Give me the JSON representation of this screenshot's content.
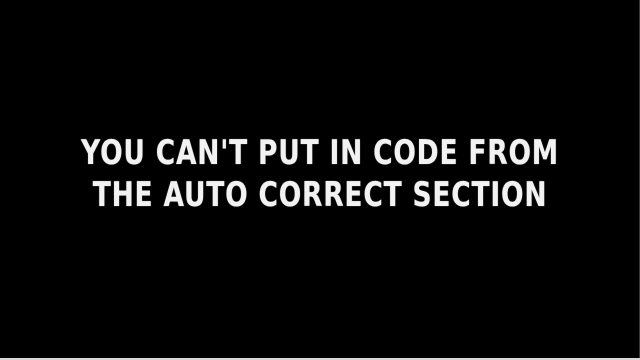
{
  "caption": {
    "line1": "YOU CAN'T PUT IN CODE FROM",
    "line2": "THE AUTO CORRECT SECTION"
  },
  "colors": {
    "background": "#000000",
    "text": "#f2f2f2"
  }
}
